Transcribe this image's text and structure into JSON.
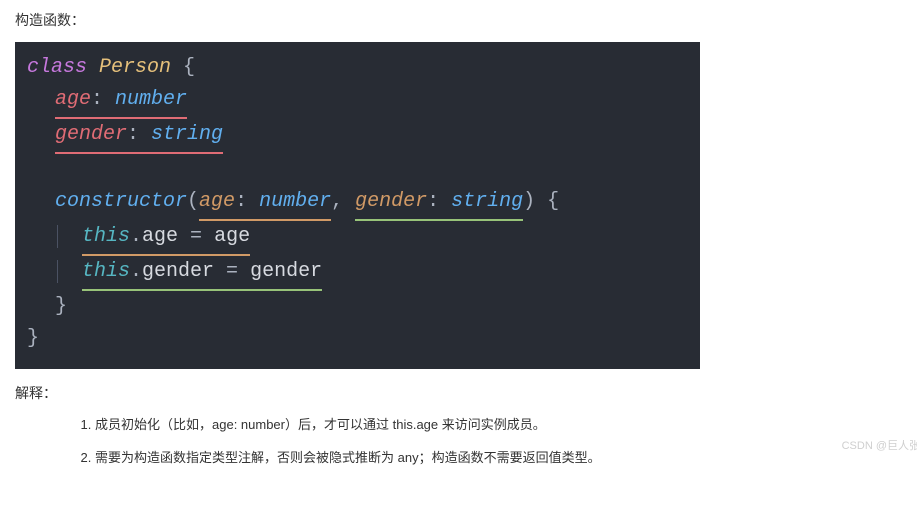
{
  "heading": "构造函数：",
  "code": {
    "kw_class": "class",
    "class_name": "Person",
    "open_brace": " {",
    "prop_age": "age",
    "colon": ": ",
    "type_number": "number",
    "prop_gender": "gender",
    "type_string": "string",
    "constructor_kw": "constructor",
    "paren_open": "(",
    "param_age": "age",
    "param_gender": "gender",
    "comma_sp": ", ",
    "paren_close_brace": ") {",
    "this_kw": "this",
    "dot": ".",
    "assign_age_prop": "age",
    "eq": " = ",
    "assign_age_val": "age",
    "assign_gender_prop": "gender",
    "assign_gender_val": "gender",
    "close_brace": "}"
  },
  "explain_heading": "解释：",
  "explain_items": [
    "成员初始化（比如，age: number）后，才可以通过 this.age 来访问实例成员。",
    "需要为构造函数指定类型注解，否则会被隐式推断为 any；构造函数不需要返回值类型。"
  ],
  "watermark": "CSDN @巨人张"
}
